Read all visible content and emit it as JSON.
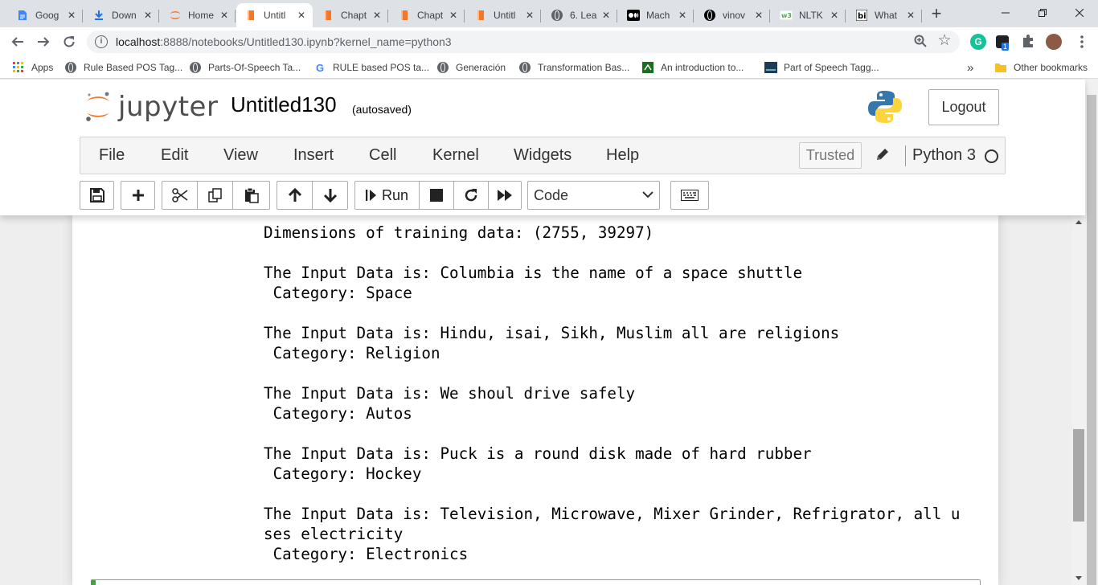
{
  "browser": {
    "tabs": [
      {
        "title": "Goog",
        "icon": "google-docs-icon",
        "color": "#4285f4"
      },
      {
        "title": "Down",
        "icon": "download-icon",
        "color": "#1a73e8"
      },
      {
        "title": "Home",
        "icon": "jupyter-icon",
        "color": "#f37726"
      },
      {
        "title": "Untitl",
        "icon": "jupyter-notebook-icon",
        "color": "#f37726",
        "active": true
      },
      {
        "title": "Chapt",
        "icon": "jupyter-notebook-icon",
        "color": "#f37726"
      },
      {
        "title": "Chapt",
        "icon": "jupyter-notebook-icon",
        "color": "#f37726"
      },
      {
        "title": "Untitl",
        "icon": "jupyter-notebook-icon",
        "color": "#f37726"
      },
      {
        "title": "6. Lea",
        "icon": "globe-icon",
        "color": "#5f6368"
      },
      {
        "title": "Mach",
        "icon": "medium-icon",
        "color": "#000000"
      },
      {
        "title": "vinov",
        "icon": "github-icon",
        "color": "#000000"
      },
      {
        "title": "NLTK",
        "icon": "w3schools-icon",
        "color": "#4caf50"
      },
      {
        "title": "What",
        "icon": "business-insider-icon",
        "color": "#000000"
      }
    ],
    "url": {
      "host": "localhost",
      "rest": ":8888/notebooks/Untitled130.ipynb?kernel_name=python3"
    },
    "bookmarks": [
      {
        "label": "Apps",
        "icon": "apps-grid-icon"
      },
      {
        "label": "Rule Based POS Tag...",
        "icon": "globe-icon"
      },
      {
        "label": "Parts-Of-Speech Ta...",
        "icon": "globe-icon"
      },
      {
        "label": "RULE based POS ta...",
        "icon": "google-icon"
      },
      {
        "label": "Generación",
        "icon": "globe-icon"
      },
      {
        "label": "Transformation Bas...",
        "icon": "globe-icon"
      },
      {
        "label": "An introduction to...",
        "icon": "mendeley-icon"
      },
      {
        "label": "Part of Speech Tagg...",
        "icon": "site-icon"
      },
      {
        "label": "»",
        "icon": "chevron-icon"
      },
      {
        "label": "Other bookmarks",
        "icon": "folder-icon"
      }
    ],
    "extension_badge": "1"
  },
  "jupyter": {
    "logo_text": "jupyter",
    "notebook_name": "Untitled130",
    "save_status": "(autosaved)",
    "logout_label": "Logout",
    "menu": [
      "File",
      "Edit",
      "View",
      "Insert",
      "Cell",
      "Kernel",
      "Widgets",
      "Help"
    ],
    "trusted_label": "Trusted",
    "kernel_name": "Python 3",
    "run_label": "Run",
    "cell_type": "Code"
  },
  "output_lines": [
    "Dimensions of training data: (2755, 39297)",
    "",
    "The Input Data is: Columbia is the name of a space shuttle",
    " Category: Space",
    "",
    "The Input Data is: Hindu, isai, Sikh, Muslim all are religions",
    " Category: Religion",
    "",
    "The Input Data is: We shoul drive safely",
    " Category: Autos",
    "",
    "The Input Data is: Puck is a round disk made of hard rubber",
    " Category: Hockey",
    "",
    "The Input Data is: Television, Microwave, Mixer Grinder, Refrigrator, all u",
    "ses electricity",
    " Category: Electronics"
  ]
}
